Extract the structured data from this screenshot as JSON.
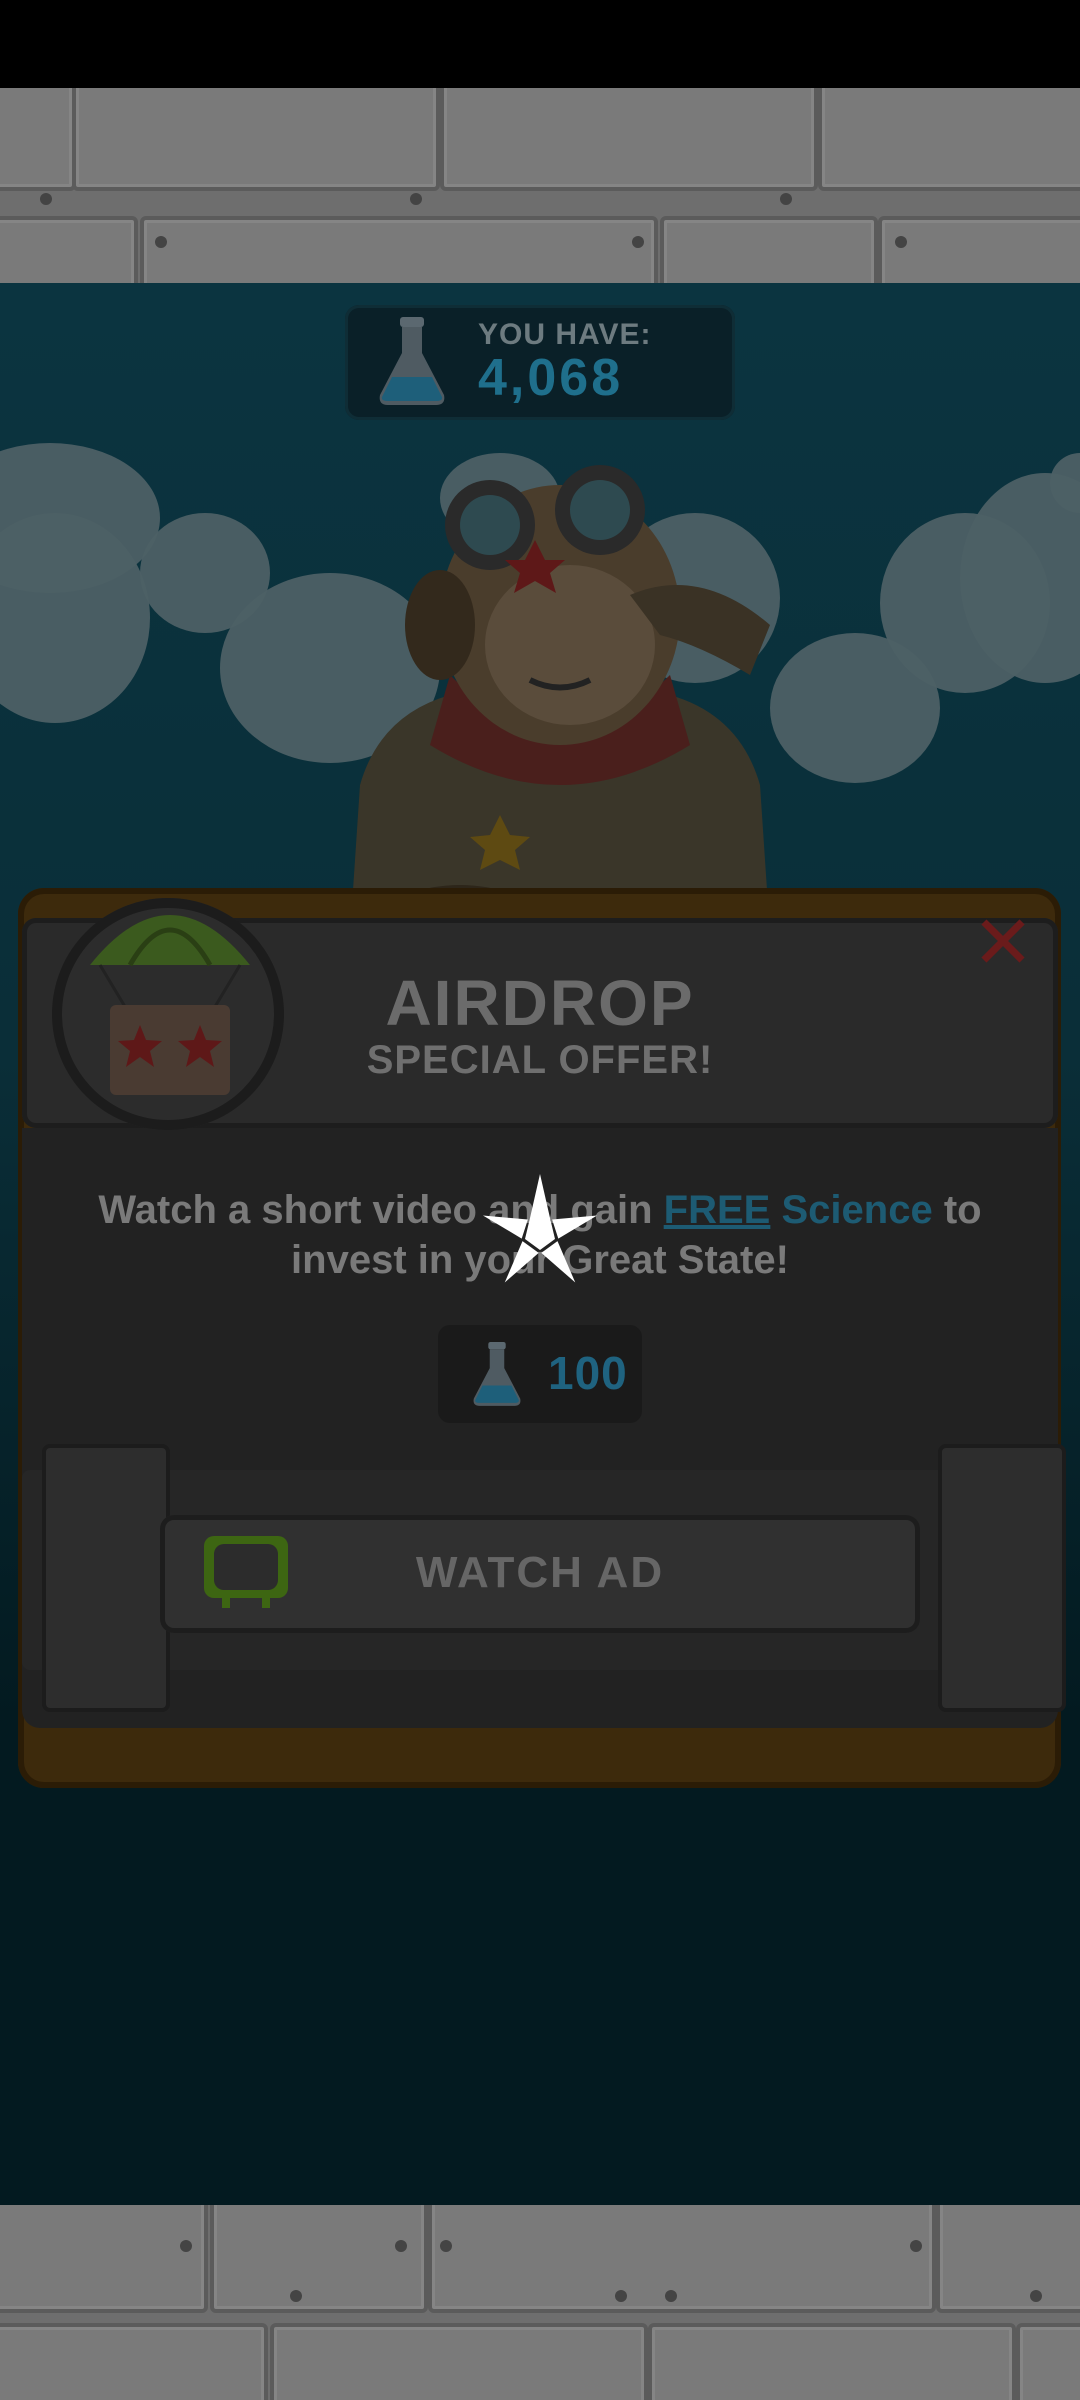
{
  "counter": {
    "label": "YOU HAVE:",
    "value": "4,068",
    "icon": "flask-icon"
  },
  "modal": {
    "title": "AIRDROP",
    "subtitle": "SPECIAL OFFER!",
    "close_icon": "close-icon",
    "badge_icon": "parachute-crate-icon",
    "description": {
      "part1": "Watch a short video and gain ",
      "free": "FREE",
      "science": "Science",
      "part2": " to invest in your Great State!"
    },
    "reward": {
      "icon": "flask-icon",
      "value": "100"
    },
    "watch_button": {
      "label": "WATCH AD",
      "icon": "tv-icon"
    }
  },
  "overlay": {
    "loading_icon": "star-spinner-icon"
  },
  "colors": {
    "science_accent": "#1f6f8c",
    "close_red": "#6a1b1b",
    "tv_green": "#4a7a15"
  }
}
